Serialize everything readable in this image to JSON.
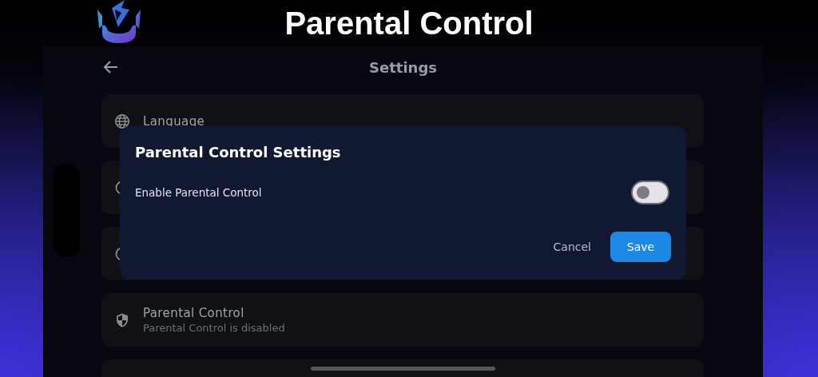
{
  "header": {
    "title": "Parental Control"
  },
  "screen": {
    "title": "Settings",
    "items": [
      {
        "kind": "globe",
        "title": "Language"
      },
      {
        "kind": "ring"
      },
      {
        "kind": "ring"
      },
      {
        "kind": "shield",
        "title": "Parental Control",
        "subtitle": "Parental Control is disabled"
      },
      {
        "kind": "none"
      }
    ]
  },
  "dialog": {
    "title": "Parental Control Settings",
    "option": {
      "label": "Enable Parental Control",
      "on": false
    },
    "buttons": [
      {
        "label": "Cancel",
        "kind": "text"
      },
      {
        "label": "Save",
        "kind": "primary"
      }
    ]
  }
}
